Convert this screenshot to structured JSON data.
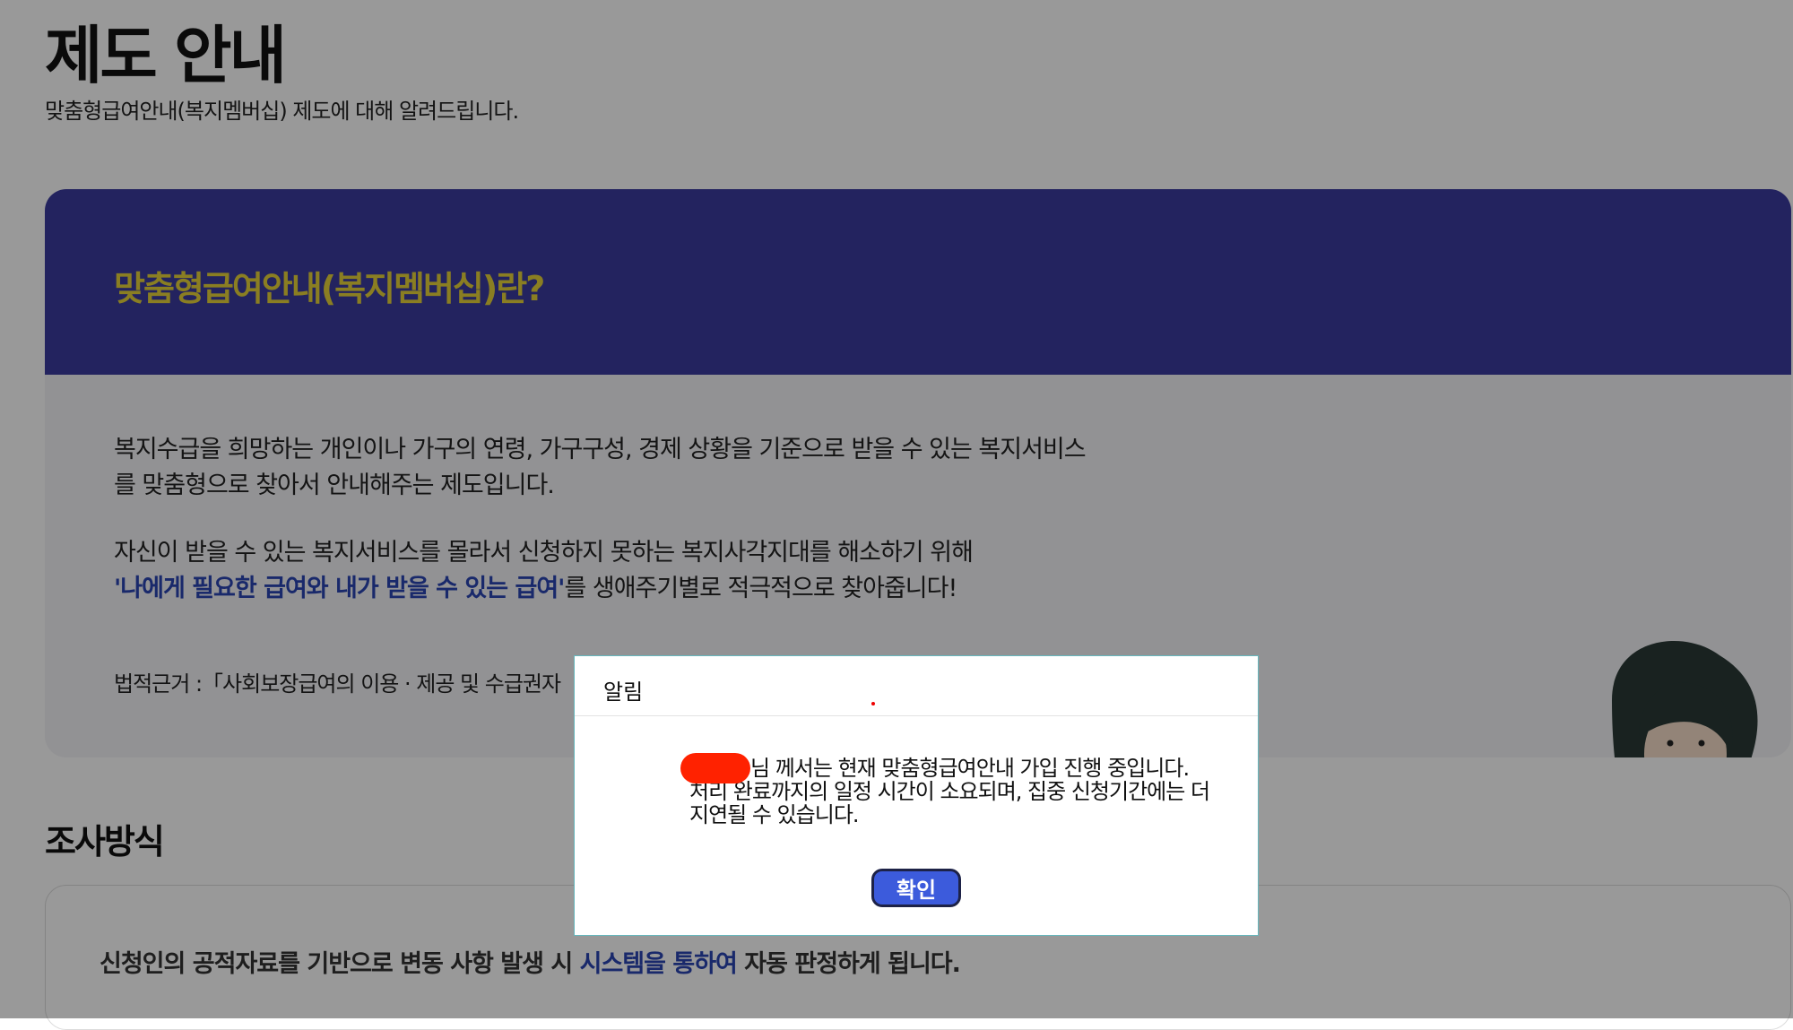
{
  "page": {
    "title": "제도 안내",
    "subtitle": "맞춤형급여안내(복지멤버십) 제도에 대해 알려드립니다."
  },
  "intro": {
    "heading": "맞춤형급여안내(복지멤버십)란?",
    "paragraph1_line1": "복지수급을 희망하는 개인이나 가구의 연령, 가구구성, 경제 상황을 기준으로 받을 수 있는 복지서비스",
    "paragraph1_line2": "를 맞춤형으로 찾아서 안내해주는 제도입니다.",
    "paragraph2_line1": "자신이 받을 수 있는 복지서비스를 몰라서 신청하지 못하는 복지사각지대를 해소하기 위해",
    "paragraph2_highlight": "'나에게 필요한 급여와 내가 받을 수 있는 급여'",
    "paragraph2_rest": "를 생애주기별로 적극적으로 찾아줍니다!",
    "legal": "법적근거 :「사회보장급여의 이용 · 제공 및 수급권자"
  },
  "survey": {
    "title": "조사방식",
    "text_before": "신청인의 공적자료를 기반으로 변동 사항 발생 시 ",
    "text_highlight": "시스템을 통하여",
    "text_after": " 자동 판정하게 됩니다."
  },
  "dialog": {
    "title": "알림",
    "message_line1": "님 께서는 현재 맞춤형급여안내 가입 진행 중입니다.",
    "message_line2": "처리 완료까지의 일정 시간이 소요되며, 집중 신청기간에는 더",
    "message_line3": "지연될 수 있습니다.",
    "confirm_label": "확인"
  },
  "colors": {
    "banner": "#3b3b9e",
    "heading_accent": "#e6d23a",
    "link_highlight": "#2b45b3",
    "confirm_button": "#3c5bdc",
    "redaction": "#ff2200"
  }
}
